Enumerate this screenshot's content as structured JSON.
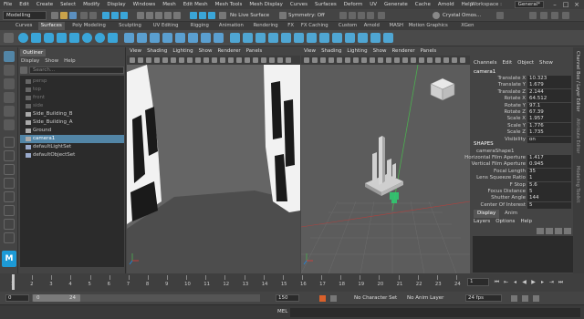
{
  "menubar": {
    "items": [
      "File",
      "Edit",
      "Create",
      "Select",
      "Modify",
      "Display",
      "Windows",
      "Mesh",
      "Edit Mesh",
      "Mesh Tools",
      "Mesh Display",
      "Curves",
      "Surfaces",
      "Deform",
      "UV",
      "Generate",
      "Cache",
      "Arnold",
      "Help"
    ],
    "workspace_label": "Workspace :",
    "workspace_value": "General*"
  },
  "statusline": {
    "mode": "Modelling",
    "live_surface": "No Live Surface",
    "symmetry": "Symmetry: Off",
    "user": "Crystal Omos..."
  },
  "shelf": {
    "tabs": [
      "Curves",
      "Surfaces",
      "Poly Modeling",
      "Sculpting",
      "UV Editing",
      "Rigging",
      "Animation",
      "Rendering",
      "FX",
      "FX Caching",
      "Custom",
      "Arnold",
      "MASH",
      "Motion Graphics",
      "XGen"
    ],
    "active_tab": "Surfaces"
  },
  "outliner": {
    "title": "Outliner",
    "menu": [
      "Display",
      "Show",
      "Help"
    ],
    "search_placeholder": "Search...",
    "items": [
      {
        "label": "persp",
        "dim": true
      },
      {
        "label": "top",
        "dim": true
      },
      {
        "label": "front",
        "dim": true
      },
      {
        "label": "side",
        "dim": true
      },
      {
        "label": "Side_Building_B",
        "dim": false
      },
      {
        "label": "Side_Building_A",
        "dim": false
      },
      {
        "label": "Ground",
        "dim": false
      },
      {
        "label": "camera1",
        "dim": false,
        "selected": true
      },
      {
        "label": "defaultLightSet",
        "dim": false
      },
      {
        "label": "defaultObjectSet",
        "dim": false
      }
    ]
  },
  "viewport_left": {
    "menu": [
      "View",
      "Shading",
      "Lighting",
      "Show",
      "Renderer",
      "Panels"
    ]
  },
  "viewport_right": {
    "menu": [
      "View",
      "Shading",
      "Lighting",
      "Show",
      "Renderer",
      "Panels"
    ]
  },
  "channelbox": {
    "menu": [
      "Channels",
      "Edit",
      "Object",
      "Show"
    ],
    "object_name": "camera1",
    "attributes": [
      {
        "name": "Translate X",
        "value": "10.323"
      },
      {
        "name": "Translate Y",
        "value": "1.679"
      },
      {
        "name": "Translate Z",
        "value": "2.144"
      },
      {
        "name": "Rotate X",
        "value": "64.512"
      },
      {
        "name": "Rotate Y",
        "value": "97.1"
      },
      {
        "name": "Rotate Z",
        "value": "67.39"
      },
      {
        "name": "Scale X",
        "value": "1.957"
      },
      {
        "name": "Scale Y",
        "value": "1.776"
      },
      {
        "name": "Scale Z",
        "value": "1.735"
      },
      {
        "name": "Visibility",
        "value": "on"
      }
    ],
    "shapes_label": "SHAPES",
    "shape_name": "cameraShape1",
    "shape_attributes": [
      {
        "name": "Horizontal Film Aperture",
        "value": "1.417"
      },
      {
        "name": "Vertical Film Aperture",
        "value": "0.945"
      },
      {
        "name": "Focal Length",
        "value": "35"
      },
      {
        "name": "Lens Squeeze Ratio",
        "value": "1"
      },
      {
        "name": "F Stop",
        "value": "5.6"
      },
      {
        "name": "Focus Distance",
        "value": "5"
      },
      {
        "name": "Shutter Angle",
        "value": "144"
      },
      {
        "name": "Center Of Interest",
        "value": "5"
      }
    ],
    "layer_tabs": [
      "Display",
      "Anim"
    ],
    "active_layer_tab": "Display",
    "layer_menu": [
      "Layers",
      "Options",
      "Help"
    ]
  },
  "sidetabs": [
    "Channel Box / Layer Editor",
    "Attribute Editor",
    "Modeling Toolkit"
  ],
  "timeslider": {
    "ticks": [
      "1",
      "2",
      "3",
      "4",
      "5",
      "6",
      "7",
      "8",
      "9",
      "10",
      "11",
      "12",
      "13",
      "14",
      "15",
      "16",
      "17",
      "18",
      "19",
      "20",
      "21",
      "22",
      "23",
      "24"
    ],
    "current_frame": "1"
  },
  "rangeslider": {
    "start": "0",
    "range_start": "0",
    "range_end": "24",
    "end": "150",
    "character_set": "No Character Set",
    "anim_layer": "No Anim Layer",
    "fps": "24 fps"
  },
  "cmdline": {
    "label": "MEL"
  },
  "colors": {
    "accent": "#5285a6",
    "shelf_blue": "#3aa5d8",
    "maya_logo": "#1d9ad6"
  }
}
